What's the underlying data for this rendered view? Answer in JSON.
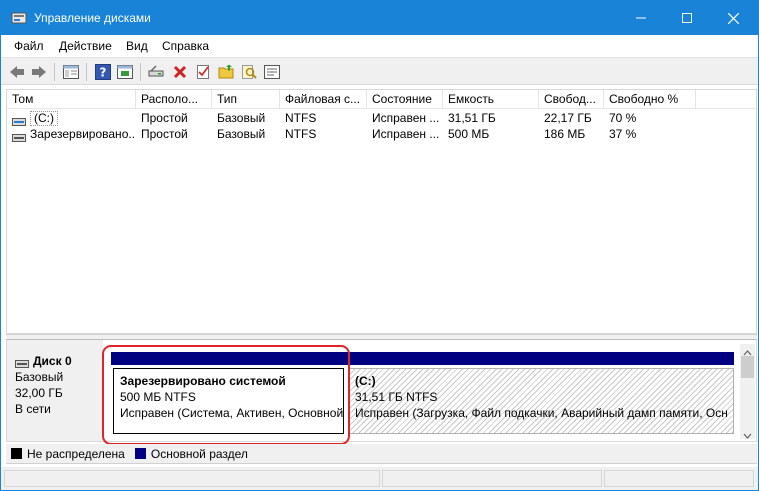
{
  "window": {
    "title": "Управление дисками",
    "accent": "#1883d7"
  },
  "menu": [
    "Файл",
    "Действие",
    "Вид",
    "Справка"
  ],
  "toolbar": {
    "icons": [
      "back-arrow-icon",
      "forward-arrow-icon",
      "console-tree-icon",
      "help-icon",
      "properties-icon",
      "connect-disk-icon",
      "delete-icon",
      "checklist-icon",
      "open-folder-icon",
      "search-icon",
      "settings-list-icon"
    ]
  },
  "volumes": {
    "columns": [
      "Том",
      "Располо...",
      "Тип",
      "Файловая с...",
      "Состояние",
      "Емкость",
      "Свобод...",
      "Свободно %"
    ],
    "rows": [
      {
        "name": "(C:)",
        "layout": "Простой",
        "type": "Базовый",
        "fs": "NTFS",
        "status": "Исправен ...",
        "capacity": "31,51 ГБ",
        "free": "22,17 ГБ",
        "free_pct": "70 %"
      },
      {
        "name": "Зарезервировано...",
        "layout": "Простой",
        "type": "Базовый",
        "fs": "NTFS",
        "status": "Исправен ...",
        "capacity": "500 МБ",
        "free": "186 МБ",
        "free_pct": "37 %"
      }
    ]
  },
  "disk": {
    "title": "Диск 0",
    "type": "Базовый",
    "size": "32,00 ГБ",
    "state": "В сети",
    "partitions": [
      {
        "title": "Зарезервировано системой",
        "size": "500 МБ NTFS",
        "status": "Исправен (Система, Активен, Основной"
      },
      {
        "title": "(C:)",
        "size": "31,51 ГБ NTFS",
        "status": "Исправен (Загрузка, Файл подкачки, Аварийный дамп памяти, Осн"
      }
    ]
  },
  "legend": [
    {
      "label": "Не распределена",
      "color": "#000000"
    },
    {
      "label": "Основной раздел",
      "color": "#000080"
    }
  ],
  "highlight_color": "#e0252a"
}
